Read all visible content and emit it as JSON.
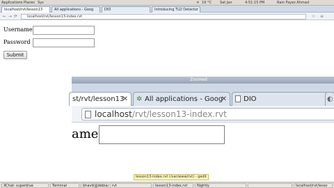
{
  "top_panel": {
    "menu_applications": "Applications",
    "menu_places": "Places",
    "menu_system": "Sys",
    "temperature": "19 °C",
    "datetime": "Sat Jan",
    "clock": "4:51:15 PM",
    "user": "Rain Fayez Ahmad"
  },
  "back_browser": {
    "tabs": [
      {
        "label": "localhost/rvt/lesson13"
      },
      {
        "label": "All applications - Goog"
      },
      {
        "label": "DIO"
      },
      {
        "label": "Introducing TLD Detector"
      }
    ],
    "url": "localhost/rvt/lesson13-index.rvt"
  },
  "form": {
    "username_label": "Username",
    "password_label": "Password",
    "submit_label": "Submit"
  },
  "front_window": {
    "title": "Zoomed",
    "tabs": [
      {
        "label": "st/rvt/lesson13"
      },
      {
        "label": "All applications - Goog"
      },
      {
        "label": "DIO"
      }
    ],
    "url_host": "localhost",
    "url_path": "/rvt/lesson13-index.rvt",
    "zoomed_label": "ame:"
  },
  "tooltip": "lesson13-index.rvt (/var/www/rvt) - gedit",
  "taskbar": {
    "items": [
      {
        "label": "XChat: superblue"
      },
      {
        "label": "Terminal"
      },
      {
        "label": "bhavik@debian"
      },
      {
        "label": "rvt"
      },
      {
        "label": "lesson13-index.rvt"
      },
      {
        "label": "Nightly"
      },
      {
        "label": ""
      },
      {
        "label": "localhost/rvt/lesso"
      }
    ]
  },
  "colors": {
    "panel": "#dedbd6",
    "tab_strip": "#cfd8e6",
    "titlebar": "#98a4b6",
    "tooltip_bg": "#fdf6b8"
  },
  "icons": [
    "close-icon",
    "puzzle-icon",
    "page-icon",
    "globe-icon"
  ]
}
